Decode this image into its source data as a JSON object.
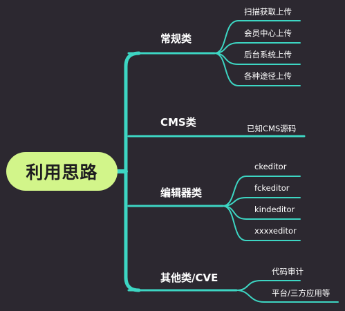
{
  "mindmap": {
    "root": {
      "label": "利用思路"
    },
    "branches": [
      {
        "label": "常规类",
        "leaves": [
          "扫描获取上传",
          "会员中心上传",
          "后台系统上传",
          "各种途径上传"
        ]
      },
      {
        "label": "CMS类",
        "leaves": [
          "已知CMS源码"
        ]
      },
      {
        "label": "编辑器类",
        "leaves": [
          "ckeditor",
          "fckeditor",
          "kindeditor",
          "xxxxeditor"
        ]
      },
      {
        "label": "其他类/CVE",
        "leaves": [
          "代码审计",
          "平台/三方应用等"
        ]
      }
    ]
  },
  "colors": {
    "background": "#2c2830",
    "connector": "#3dd6c3",
    "root_fill": "#d2f58a",
    "text": "#ffffff"
  }
}
